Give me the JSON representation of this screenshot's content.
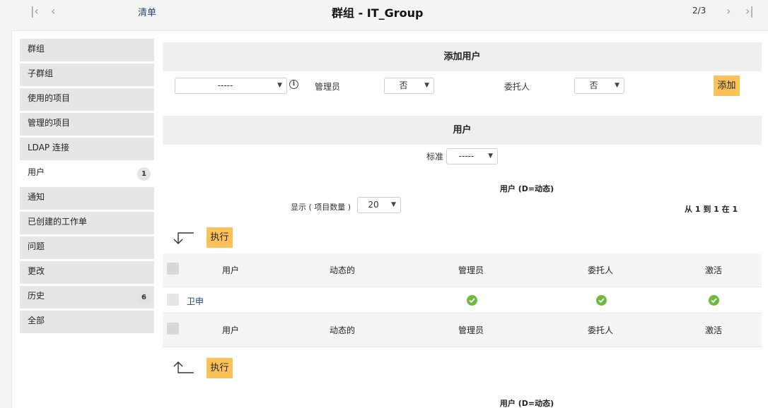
{
  "header": {
    "list_label": "清单",
    "title": "群组 - IT_Group",
    "pager": "2/3"
  },
  "sidebar": {
    "items": [
      {
        "label": "群组",
        "badge": null
      },
      {
        "label": "子群组",
        "badge": null
      },
      {
        "label": "使用的项目",
        "badge": null
      },
      {
        "label": "管理的项目",
        "badge": null
      },
      {
        "label": "LDAP 连接",
        "badge": null
      },
      {
        "label": "用户",
        "badge": "1"
      },
      {
        "label": "通知",
        "badge": null
      },
      {
        "label": "已创建的工作单",
        "badge": null
      },
      {
        "label": "问题",
        "badge": null
      },
      {
        "label": "更改",
        "badge": null
      },
      {
        "label": "历史",
        "badge": "6"
      },
      {
        "label": "全部",
        "badge": null
      }
    ]
  },
  "add_user": {
    "section_title": "添加用户",
    "user_select": "-----",
    "admin_label": "管理员",
    "admin_value": "否",
    "delegate_label": "委托人",
    "delegate_value": "否",
    "add_button": "添加"
  },
  "users": {
    "section_title": "用户",
    "criteria_label": "标准",
    "criteria_value": "-----",
    "legend": "用户 (D=动态)",
    "show_label": "显示 ( 项目数量 )",
    "show_value": "20",
    "range_text": "从 1 到 1 在 1",
    "execute_label": "执行",
    "columns": [
      "用户",
      "动态的",
      "管理员",
      "委托人",
      "激活"
    ],
    "rows": [
      {
        "user": "卫申",
        "dynamic": "",
        "admin": true,
        "delegate": true,
        "active": true
      }
    ]
  }
}
